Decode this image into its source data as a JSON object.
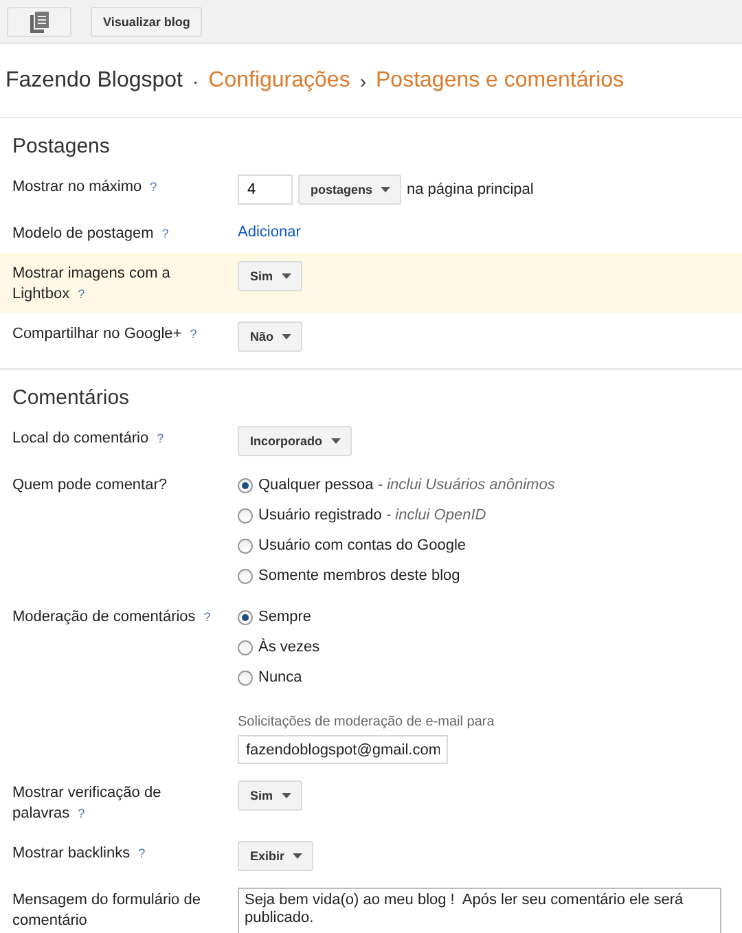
{
  "toolbar": {
    "buttons": [
      {
        "kind": "icon"
      },
      {
        "kind": "text",
        "label": "Visualizar blog"
      }
    ]
  },
  "breadcrumb": [
    {
      "kind": "title",
      "text": "Fazendo Blogspot"
    },
    {
      "kind": "sep",
      "text": "·"
    },
    {
      "kind": "link",
      "text": "Configurações"
    },
    {
      "kind": "sep",
      "text": "›"
    },
    {
      "kind": "current",
      "text": "Postagens e comentários"
    }
  ],
  "sections": [
    {
      "title": "Postagens",
      "rows": [
        {
          "label": "Mostrar no máximo",
          "help": "?",
          "highlighted": false,
          "kind": "count",
          "value": "4",
          "select": "postagens",
          "suffix": "na página principal"
        },
        {
          "label": "Modelo de postagem",
          "help": "?",
          "highlighted": false,
          "kind": "link",
          "link": "Adicionar"
        },
        {
          "label": "Mostrar imagens com a Lightbox",
          "help": "?",
          "highlighted": true,
          "kind": "select",
          "select": "Sim"
        },
        {
          "label": "Compartilhar no Google+",
          "help": "?",
          "highlighted": false,
          "kind": "select",
          "select": "Não"
        }
      ]
    },
    {
      "title": "Comentários",
      "rows": [
        {
          "label": "Local do comentário",
          "help": "?",
          "highlighted": false,
          "kind": "select",
          "select": "Incorporado"
        },
        {
          "label": "Quem pode comentar?",
          "highlighted": false,
          "kind": "radios",
          "options": [
            {
              "text": "Qualquer pessoa",
              "note": "- inclui Usuários anônimos",
              "selected": true
            },
            {
              "text": "Usuário registrado",
              "note": "- inclui OpenID",
              "selected": false
            },
            {
              "text": "Usuário com contas do Google",
              "selected": false
            },
            {
              "text": "Somente membros deste blog",
              "selected": false
            }
          ]
        },
        {
          "label": "Moderação de comentários",
          "help": "?",
          "highlighted": false,
          "kind": "radios",
          "options": [
            {
              "text": "Sempre",
              "selected": true
            },
            {
              "text": "Às vezes",
              "selected": false
            },
            {
              "text": "Nunca",
              "selected": false
            }
          ],
          "email_label": "Solicitações de moderação de e-mail para",
          "email": "fazendoblogspot@gmail.com"
        },
        {
          "label": "Mostrar verificação de palavras",
          "help": "?",
          "highlighted": false,
          "kind": "select",
          "select": "Sim"
        },
        {
          "label": "Mostrar backlinks",
          "help": "?",
          "highlighted": false,
          "kind": "select",
          "select": "Exibir"
        },
        {
          "label": "Mensagem do formulário de comentário",
          "highlighted": false,
          "kind": "textarea",
          "value": "Seja bem vida(o) ao meu blog !  Após ler seu comentário ele será publicado."
        }
      ]
    }
  ]
}
